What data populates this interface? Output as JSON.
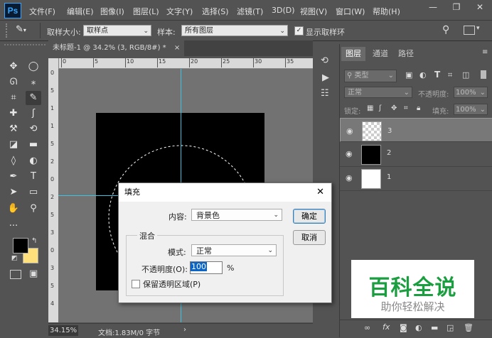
{
  "app": {
    "logo": "Ps"
  },
  "menu": [
    "文件(F)",
    "编辑(E)",
    "图像(I)",
    "图层(L)",
    "文字(Y)",
    "选择(S)",
    "滤镜(T)",
    "3D(D)",
    "视图(V)",
    "窗口(W)",
    "帮助(H)"
  ],
  "window_controls": {
    "minimize": "—",
    "restore": "❐",
    "close": "✕"
  },
  "options": {
    "sample_size_label": "取样大小:",
    "sample_size_value": "取样点",
    "sample_label": "样本:",
    "sample_value": "所有图层",
    "show_ring_label": "显示取样环"
  },
  "document": {
    "tab_title": "未标题-1 @ 34.2% (3, RGB/8#) *",
    "tab_close": "×"
  },
  "ruler_top_ticks": [
    "0",
    "5",
    "10",
    "15",
    "20",
    "25",
    "30",
    "35"
  ],
  "ruler_left_ticks": [
    "0",
    "5",
    "1",
    "1",
    "5",
    "2",
    "0",
    "2",
    "5",
    "3",
    "0",
    "3",
    "5",
    "4"
  ],
  "status": {
    "zoom": "34.15%",
    "doc_info": "文档:1.83M/0 字节",
    "arrow": "›"
  },
  "colors": {
    "foreground": "#000000",
    "background": "#ffe07a",
    "guide": "#3ec4e0",
    "ui_dark": "#535353"
  },
  "tools": [
    {
      "icon": "move-icon",
      "glyph": "✥"
    },
    {
      "icon": "ellipse-marquee-icon",
      "glyph": "◯"
    },
    {
      "icon": "lasso-icon",
      "glyph": "ᘏ"
    },
    {
      "icon": "magic-wand-icon",
      "glyph": "⁎"
    },
    {
      "icon": "crop-icon",
      "glyph": "⌗"
    },
    {
      "icon": "eyedropper-icon",
      "glyph": "✎"
    },
    {
      "icon": "healing-brush-icon",
      "glyph": "✚"
    },
    {
      "icon": "brush-icon",
      "glyph": "ʃ"
    },
    {
      "icon": "clone-stamp-icon",
      "glyph": "⚒"
    },
    {
      "icon": "history-brush-icon",
      "glyph": "⟲"
    },
    {
      "icon": "eraser-icon",
      "glyph": "◪"
    },
    {
      "icon": "gradient-icon",
      "glyph": "▬"
    },
    {
      "icon": "blur-icon",
      "glyph": "◊"
    },
    {
      "icon": "dodge-icon",
      "glyph": "◐"
    },
    {
      "icon": "pen-icon",
      "glyph": "✒"
    },
    {
      "icon": "type-icon",
      "glyph": "T"
    },
    {
      "icon": "path-selection-icon",
      "glyph": "➤"
    },
    {
      "icon": "rectangle-icon",
      "glyph": "▭"
    },
    {
      "icon": "hand-icon",
      "glyph": "✋"
    },
    {
      "icon": "zoom-icon",
      "glyph": "⚲"
    },
    {
      "icon": "more-icon",
      "glyph": "···"
    }
  ],
  "layers_panel": {
    "tabs": [
      "图层",
      "通道",
      "路径"
    ],
    "filter_label": "类型",
    "blend_mode": "正常",
    "opacity_label": "不透明度:",
    "opacity_value": "100%",
    "lock_label": "锁定:",
    "fill_label": "填充:",
    "fill_value": "100%",
    "layers": [
      {
        "name": "3",
        "thumb": "transparent"
      },
      {
        "name": "2",
        "thumb": "black"
      },
      {
        "name": "1",
        "thumb": "white"
      }
    ],
    "footer_icons": [
      "link-icon",
      "fx-icon",
      "mask-icon",
      "adjustment-icon",
      "group-icon",
      "new-layer-icon",
      "trash-icon"
    ],
    "fx_label": "fx"
  },
  "fill_dialog": {
    "title": "填充",
    "close": "✕",
    "content_label": "内容:",
    "content_value": "背景色",
    "blend_group": "混合",
    "mode_label": "模式:",
    "mode_value": "正常",
    "opacity_label": "不透明度(O):",
    "opacity_value": "100",
    "opacity_unit": "%",
    "preserve_label": "保留透明区域(P)",
    "ok": "确定",
    "cancel": "取消"
  },
  "watermark": {
    "title": "百科全说",
    "subtitle": "助你轻松解决"
  }
}
